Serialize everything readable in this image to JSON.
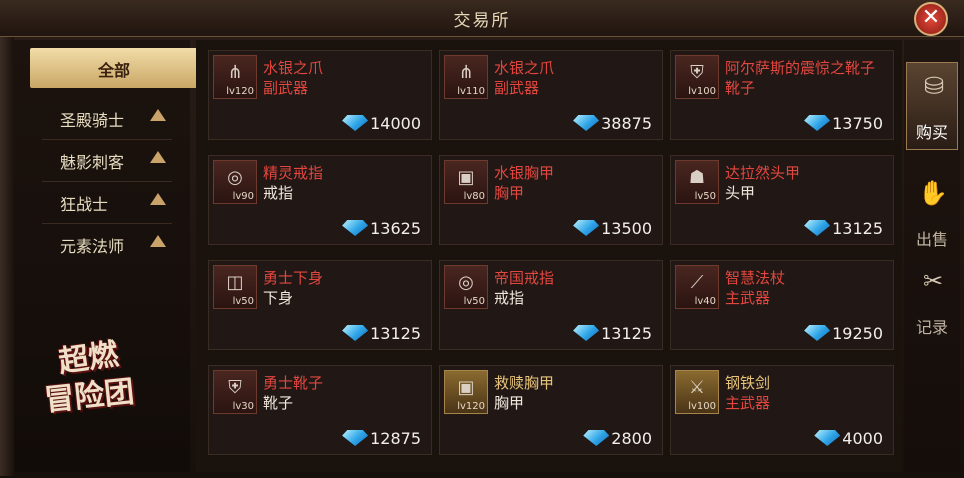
{
  "window": {
    "title": "交易所",
    "close_label": "✕"
  },
  "categories": [
    {
      "label": "全部",
      "active": true
    },
    {
      "label": "圣殿骑士",
      "active": false
    },
    {
      "label": "魅影刺客",
      "active": false
    },
    {
      "label": "狂战士",
      "active": false
    },
    {
      "label": "元素法师",
      "active": false
    }
  ],
  "logo": {
    "line1": "超燃",
    "line2": "冒险团"
  },
  "items": [
    {
      "name": "水银之爪",
      "type": "副武器",
      "level": "lv120",
      "price": "14000",
      "icon": "claw-icon",
      "rarity": "red"
    },
    {
      "name": "水银之爪",
      "type": "副武器",
      "level": "lv110",
      "price": "38875",
      "icon": "claw-icon",
      "rarity": "red"
    },
    {
      "name": "阿尔萨斯的震惊之靴子",
      "type": "靴子",
      "level": "lv100",
      "price": "13750",
      "icon": "boots-icon",
      "rarity": "red"
    },
    {
      "name": "精灵戒指",
      "type": "戒指",
      "level": "lv90",
      "price": "13625",
      "icon": "ring-icon",
      "rarity": "red"
    },
    {
      "name": "水银胸甲",
      "type": "胸甲",
      "level": "lv80",
      "price": "13500",
      "icon": "chest-armor-icon",
      "rarity": "red"
    },
    {
      "name": "达拉然头甲",
      "type": "头甲",
      "level": "lv50",
      "price": "13125",
      "icon": "helmet-icon",
      "rarity": "red"
    },
    {
      "name": "勇士下身",
      "type": "下身",
      "level": "lv50",
      "price": "13125",
      "icon": "legs-armor-icon",
      "rarity": "red"
    },
    {
      "name": "帝国戒指",
      "type": "戒指",
      "level": "lv50",
      "price": "13125",
      "icon": "ring-icon",
      "rarity": "red"
    },
    {
      "name": "智慧法杖",
      "type": "主武器",
      "level": "lv40",
      "price": "19250",
      "icon": "staff-icon",
      "rarity": "red"
    },
    {
      "name": "勇士靴子",
      "type": "靴子",
      "level": "lv30",
      "price": "12875",
      "icon": "boots-icon",
      "rarity": "red"
    },
    {
      "name": "救赎胸甲",
      "type": "胸甲",
      "level": "lv120",
      "price": "2800",
      "icon": "chest-armor-icon",
      "rarity": "gold"
    },
    {
      "name": "钢铁剑",
      "type": "主武器",
      "level": "lv100",
      "price": "4000",
      "icon": "sword-icon",
      "rarity": "gold"
    }
  ],
  "side_tabs": [
    {
      "label": "购买",
      "icon": "coins-icon",
      "active": true
    },
    {
      "label": "出售",
      "icon": "sell-icon",
      "active": false
    },
    {
      "label": "记录",
      "icon": "record-icon",
      "active": false
    }
  ],
  "colors": {
    "accent_gold": "#c9a766",
    "rarity_red": "#e2473f",
    "rarity_gold": "#e7c47a"
  }
}
